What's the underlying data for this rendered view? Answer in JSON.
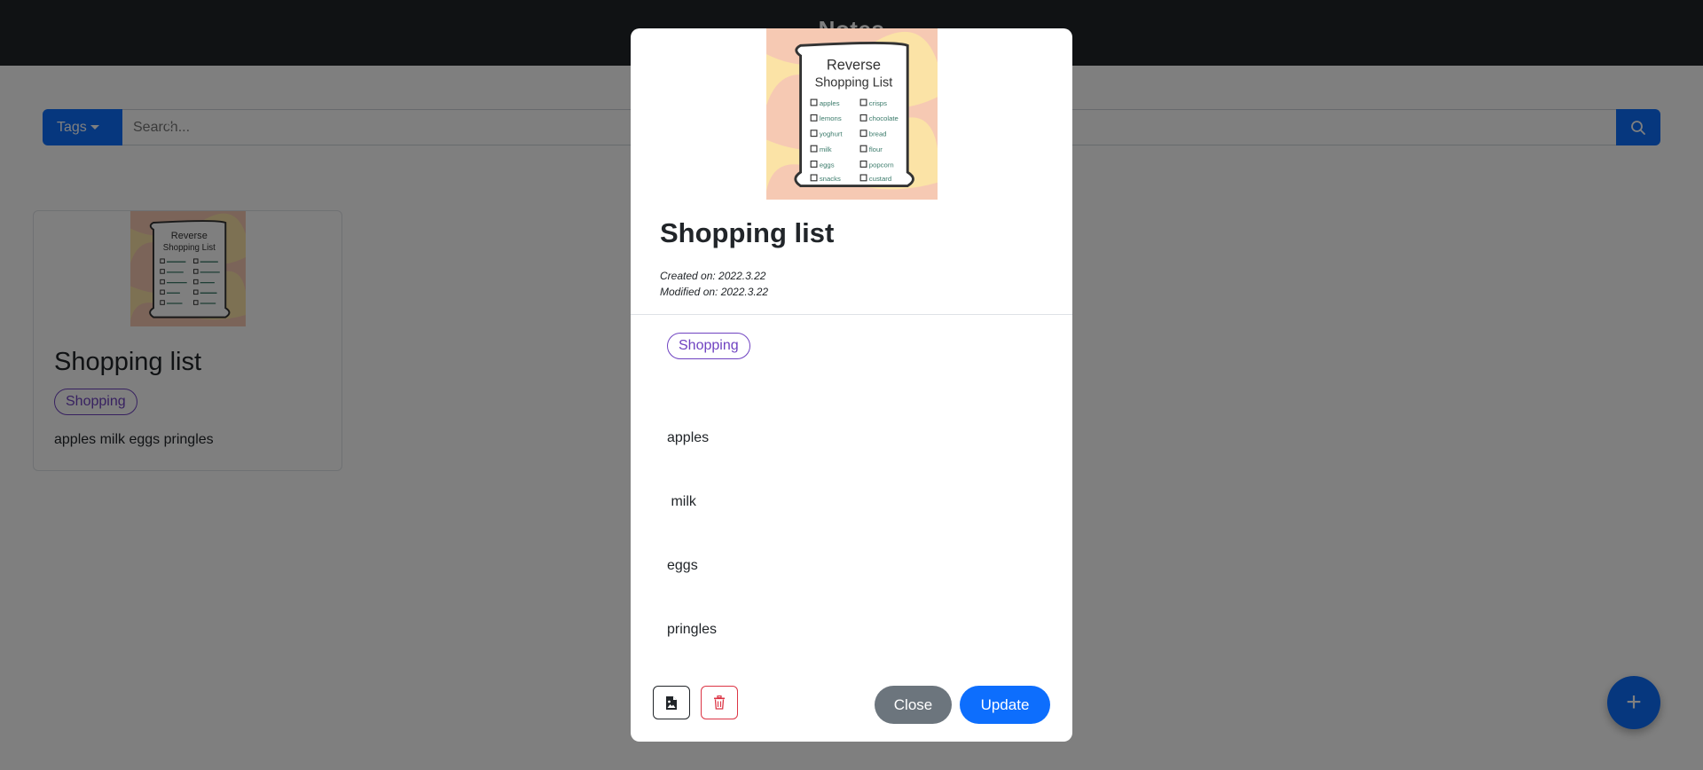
{
  "app": {
    "title": "Notes"
  },
  "search": {
    "tags_label": "Tags",
    "clear_label": "×",
    "placeholder": "Search..."
  },
  "card": {
    "title": "Shopping list",
    "tag": "Shopping",
    "preview": "apples milk eggs pringles"
  },
  "modal": {
    "title": "Shopping list",
    "created": "Created on: 2022.3.22",
    "modified": "Modified on: 2022.3.22",
    "tag": "Shopping",
    "lines": [
      "apples",
      " milk",
      "eggs",
      "pringles"
    ],
    "close_label": "Close",
    "update_label": "Update"
  },
  "fab": {
    "label": "+"
  },
  "image_text": {
    "heading": "Reverse",
    "subheading": "Shopping List",
    "items": [
      "apples",
      "lemons",
      "yoghurt",
      "milk",
      "eggs",
      "snacks",
      "crisps",
      "chocolate",
      "bread",
      "flour",
      "popcorn",
      "custard"
    ]
  },
  "colors": {
    "primary": "#0d6efd",
    "secondary": "#6c757d",
    "danger": "#dc3545",
    "tag": "#6f42c1",
    "navbar": "#212529"
  }
}
